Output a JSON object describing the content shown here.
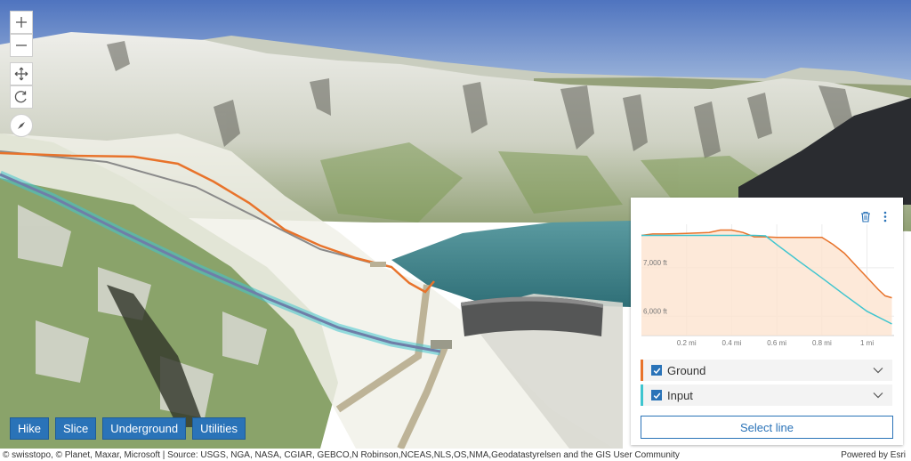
{
  "map": {
    "view": "3D scene - alpine reservoir with dam and underground pipelines",
    "colors": {
      "sky_top": "#4f74bf",
      "sky_bottom": "#a9bfdf",
      "ground_line": "#e8732b",
      "input_line": "#3fc5cf",
      "dam": "#5a5a5a",
      "lake": "#3c7d83"
    }
  },
  "navigation": {
    "zoom_in": "zoom-in",
    "zoom_out": "zoom-out",
    "pan": "pan",
    "rotate": "rotate",
    "compass": "compass"
  },
  "toolbar": {
    "hike": "Hike",
    "slice": "Slice",
    "underground": "Underground",
    "utilities": "Utilities"
  },
  "attribution": {
    "sources": "© swisstopo, © Planet, Maxar, Microsoft | Source: USGS, NGA, NASA, CGIAR, GEBCO,N Robinson,NCEAS,NLS,OS,NMA,Geodatastyrelsen and the GIS User Community",
    "powered_by": "Powered by Esri"
  },
  "elevation_profile": {
    "select_line_label": "Select line",
    "legend": [
      {
        "name": "Ground",
        "color": "#e8732b"
      },
      {
        "name": "Input",
        "color": "#3fc5cf"
      }
    ]
  },
  "chart_data": {
    "type": "area",
    "x_unit": "mi",
    "y_unit": "ft",
    "xlim": [
      0,
      1.12
    ],
    "ylim": [
      5600,
      7900
    ],
    "x_ticks": [
      "0.2 mi",
      "0.4 mi",
      "0.6 mi",
      "0.8 mi",
      "1 mi"
    ],
    "x_tick_values": [
      0.2,
      0.4,
      0.6,
      0.8,
      1.0
    ],
    "y_ticks": [
      "7,000 ft",
      "6,000 ft"
    ],
    "y_tick_values": [
      7000,
      6000
    ],
    "series": [
      {
        "name": "Ground",
        "x": [
          0,
          0.05,
          0.1,
          0.2,
          0.3,
          0.35,
          0.4,
          0.45,
          0.5,
          0.55,
          0.6,
          0.65,
          0.75,
          0.8,
          0.82,
          0.85,
          0.9,
          0.95,
          1.0,
          1.05,
          1.08,
          1.11
        ],
        "values": [
          7670,
          7700,
          7700,
          7710,
          7730,
          7780,
          7780,
          7730,
          7640,
          7640,
          7630,
          7630,
          7630,
          7630,
          7570,
          7480,
          7300,
          7050,
          6800,
          6550,
          6420,
          6380
        ]
      },
      {
        "name": "Input",
        "x": [
          0,
          0.1,
          0.2,
          0.3,
          0.4,
          0.5,
          0.55,
          0.6,
          0.7,
          0.8,
          0.9,
          1.0,
          1.11
        ],
        "values": [
          7670,
          7670,
          7670,
          7670,
          7670,
          7670,
          7660,
          7480,
          7130,
          6790,
          6440,
          6100,
          5840
        ]
      }
    ]
  }
}
